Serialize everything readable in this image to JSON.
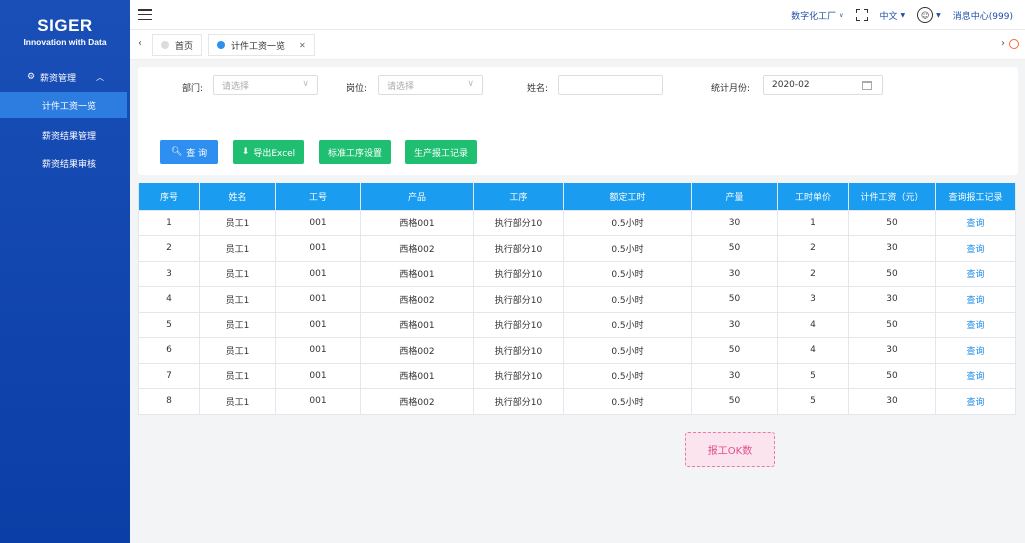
{
  "logo": {
    "title": "SIGER",
    "subtitle": "Innovation with Data"
  },
  "sidebar": {
    "group_label": "薪资管理",
    "items": [
      {
        "label": "计件工资一览",
        "active": true
      },
      {
        "label": "薪资结果管理",
        "active": false
      },
      {
        "label": "薪资结果审核",
        "active": false
      }
    ]
  },
  "header": {
    "factory": "数字化工厂",
    "language": "中文",
    "messages": "消息中心(999)"
  },
  "tabs": [
    {
      "label": "首页",
      "dot_color": "#dcdcdc"
    },
    {
      "label": "计件工资一览",
      "dot_color": "#2e8ff0"
    }
  ],
  "filter": {
    "department_label": "部门:",
    "department_placeholder": "请选择",
    "position_label": "岗位:",
    "position_placeholder": "请选择",
    "name_label": "姓名:",
    "name_value": "",
    "month_label": "统计月份:",
    "month_value": "2020-02"
  },
  "buttons": {
    "query": "查 询",
    "export": "导出Excel",
    "standard": "标准工序设置",
    "production": "生产报工记录"
  },
  "table": {
    "headers": [
      "序号",
      "姓名",
      "工号",
      "产品",
      "工序",
      "额定工时",
      "产量",
      "工时单价",
      "计件工资（元）",
      "查询报工记录"
    ],
    "rows": [
      [
        "1",
        "员工1",
        "001",
        "西格001",
        "执行部分10",
        "0.5小时",
        "30",
        "1",
        "50",
        "查询"
      ],
      [
        "2",
        "员工1",
        "001",
        "西格002",
        "执行部分10",
        "0.5小时",
        "50",
        "2",
        "30",
        "查询"
      ],
      [
        "3",
        "员工1",
        "001",
        "西格001",
        "执行部分10",
        "0.5小时",
        "30",
        "2",
        "50",
        "查询"
      ],
      [
        "4",
        "员工1",
        "001",
        "西格002",
        "执行部分10",
        "0.5小时",
        "50",
        "3",
        "30",
        "查询"
      ],
      [
        "5",
        "员工1",
        "001",
        "西格001",
        "执行部分10",
        "0.5小时",
        "30",
        "4",
        "50",
        "查询"
      ],
      [
        "6",
        "员工1",
        "001",
        "西格002",
        "执行部分10",
        "0.5小时",
        "50",
        "4",
        "30",
        "查询"
      ],
      [
        "7",
        "员工1",
        "001",
        "西格001",
        "执行部分10",
        "0.5小时",
        "30",
        "5",
        "50",
        "查询"
      ],
      [
        "8",
        "员工1",
        "001",
        "西格002",
        "执行部分10",
        "0.5小时",
        "50",
        "5",
        "30",
        "查询"
      ]
    ]
  },
  "ok_box": "报工OK数"
}
